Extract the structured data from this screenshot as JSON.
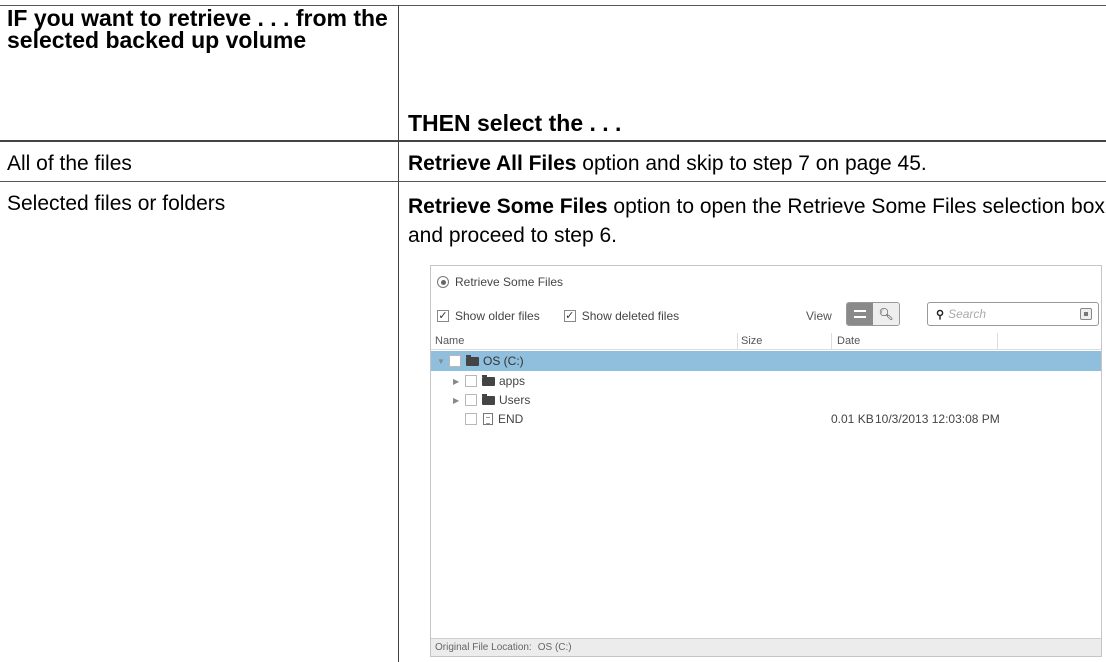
{
  "table": {
    "header_col1": "IF you want to retrieve . . . from the selected backed up volume",
    "header_col2": "THEN select the . . .",
    "rows": [
      {
        "condition": "All of the files",
        "action_bold": "Retrieve All Files",
        "action_rest": " option and skip to step 7 on page 45."
      },
      {
        "condition": "Selected files or folders",
        "action_bold": "Retrieve Some Files",
        "action_rest": " option to open the Retrieve Some Files selection box and proceed to step 6."
      }
    ]
  },
  "dialog": {
    "title": "Retrieve Some Files",
    "show_older": "Show older files",
    "show_deleted": "Show deleted files",
    "view_label": "View",
    "search_placeholder": "Search",
    "columns": [
      "Name",
      "Size",
      "Date"
    ],
    "tree": [
      {
        "label": "OS (C:)",
        "type": "folder",
        "expanded": true,
        "selected": true,
        "size": "",
        "date": ""
      },
      {
        "label": "apps",
        "type": "folder",
        "expanded": false,
        "selected": false,
        "size": "",
        "date": ""
      },
      {
        "label": "Users",
        "type": "folder",
        "expanded": false,
        "selected": false,
        "size": "",
        "date": ""
      },
      {
        "label": "END",
        "type": "file",
        "expanded": false,
        "selected": false,
        "size": "0.01 KB",
        "date": "10/3/2013 12:03:08 PM"
      }
    ],
    "footer_label": "Original File Location:",
    "footer_value": "OS (C:)"
  }
}
